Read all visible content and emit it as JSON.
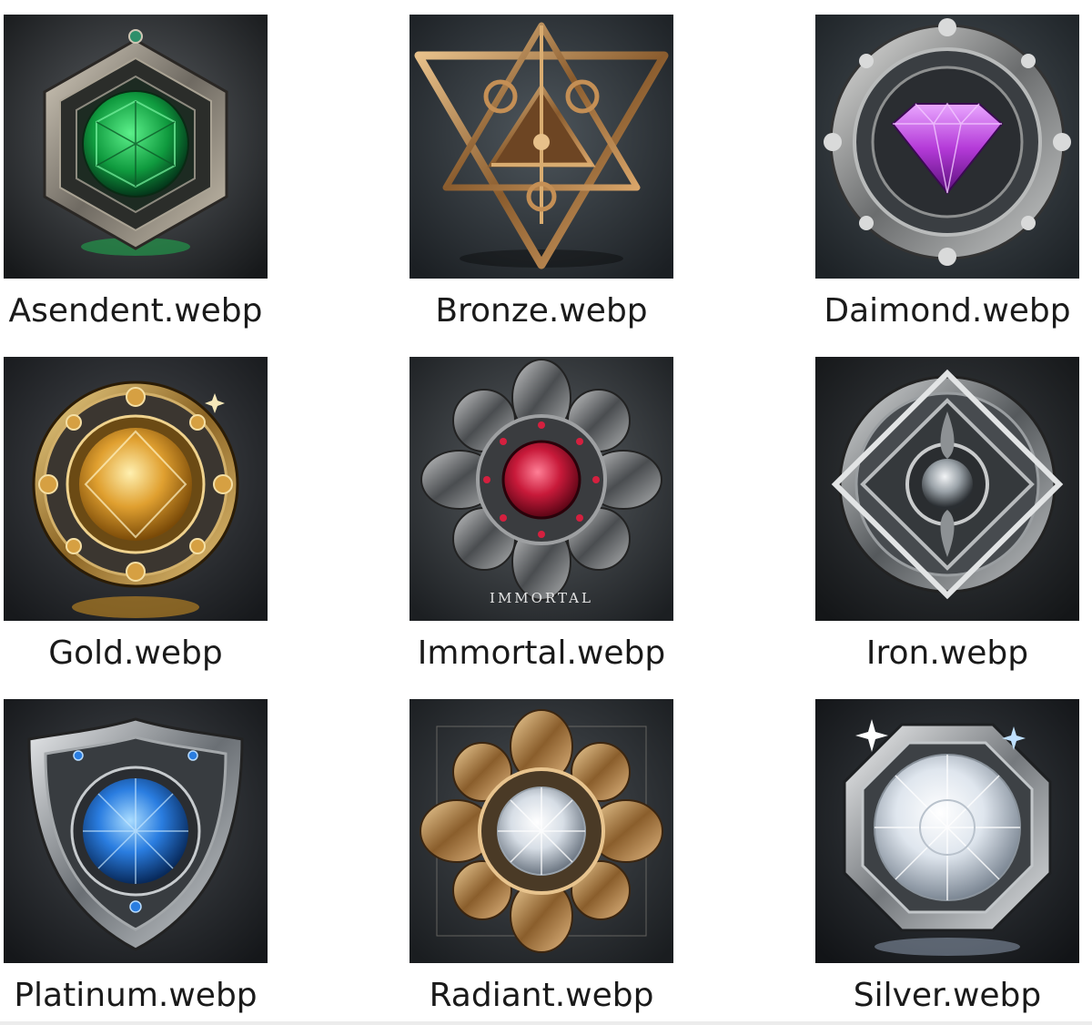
{
  "files": [
    {
      "name": "Asendent.webp",
      "icon": "emerald-hexagon-badge-icon",
      "gem_color": "#1fb050"
    },
    {
      "name": "Bronze.webp",
      "icon": "bronze-star-tetrahedron-badge-icon",
      "gem_color": "#b98a55"
    },
    {
      "name": "Daimond.webp",
      "icon": "purple-diamond-ornate-badge-icon",
      "gem_color": "#b43ad8"
    },
    {
      "name": "Gold.webp",
      "icon": "gold-gem-round-badge-icon",
      "gem_color": "#e0a030"
    },
    {
      "name": "Immortal.webp",
      "icon": "ruby-flower-badge-icon",
      "gem_color": "#c81a3a",
      "image_text": "IMMORTAL"
    },
    {
      "name": "Iron.webp",
      "icon": "iron-diamond-ornate-badge-icon",
      "gem_color": "#9aa2a8"
    },
    {
      "name": "Platinum.webp",
      "icon": "sapphire-shield-badge-icon",
      "gem_color": "#2a7de0"
    },
    {
      "name": "Radiant.webp",
      "icon": "white-diamond-golden-flower-badge-icon",
      "gem_color": "#e8eef4"
    },
    {
      "name": "Silver.webp",
      "icon": "silver-octagon-diamond-badge-icon",
      "gem_color": "#dfe6ee"
    }
  ]
}
